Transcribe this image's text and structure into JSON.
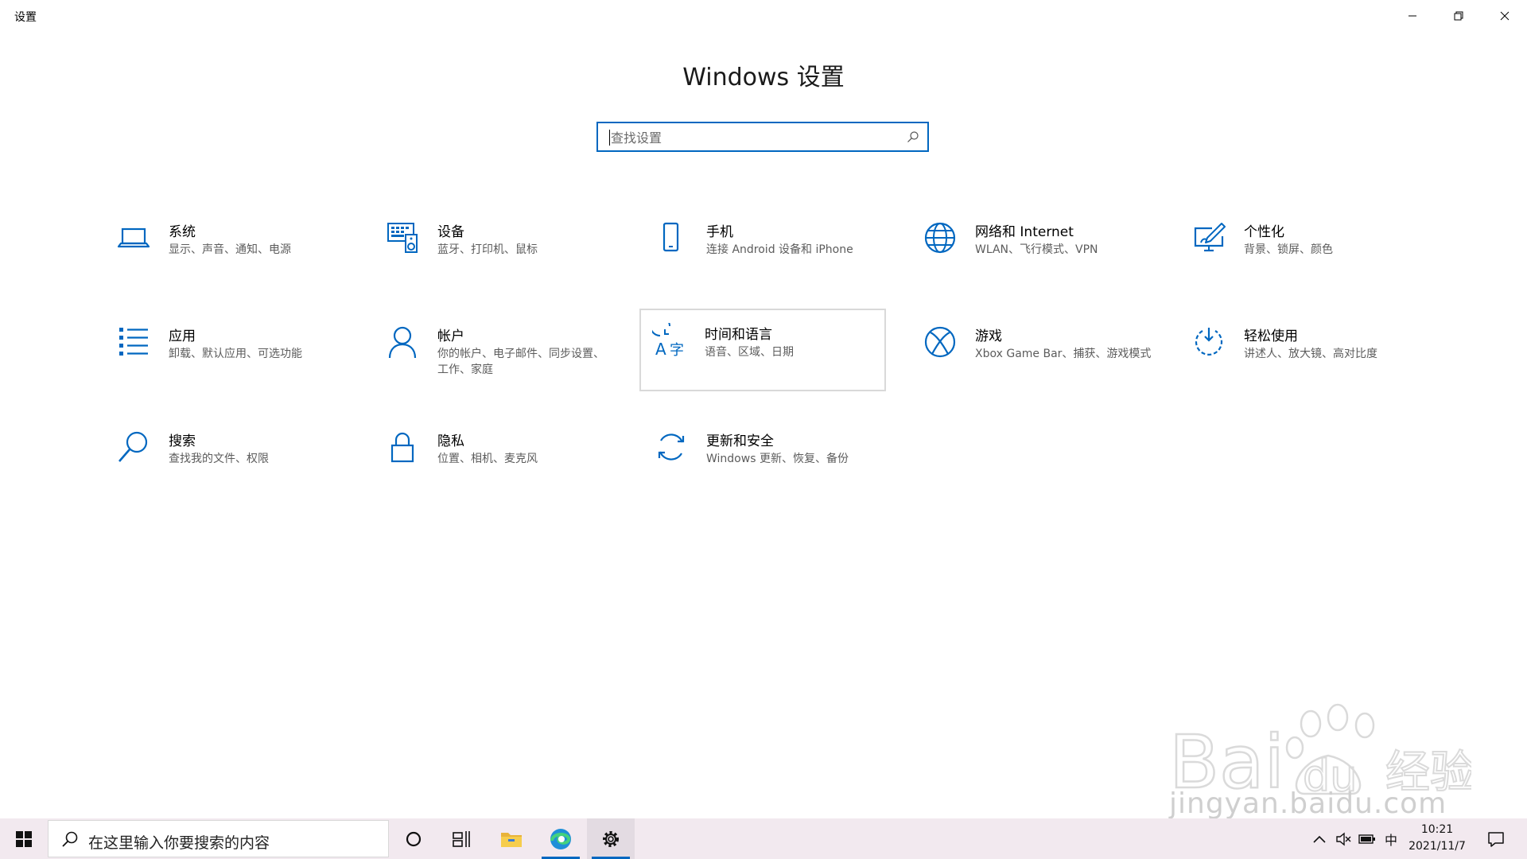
{
  "window": {
    "title": "设置"
  },
  "heading": "Windows 设置",
  "search": {
    "placeholder": "查找设置"
  },
  "tiles": [
    {
      "name": "系统",
      "desc": "显示、声音、通知、电源",
      "icon": "laptop-icon"
    },
    {
      "name": "设备",
      "desc": "蓝牙、打印机、鼠标",
      "icon": "devices-icon"
    },
    {
      "name": "手机",
      "desc": "连接 Android 设备和 iPhone",
      "icon": "phone-icon"
    },
    {
      "name": "网络和 Internet",
      "desc": "WLAN、飞行模式、VPN",
      "icon": "globe-icon"
    },
    {
      "name": "个性化",
      "desc": "背景、锁屏、颜色",
      "icon": "personalization-icon"
    },
    {
      "name": "应用",
      "desc": "卸载、默认应用、可选功能",
      "icon": "apps-list-icon"
    },
    {
      "name": "帐户",
      "desc": "你的帐户、电子邮件、同步设置、工作、家庭",
      "icon": "person-icon"
    },
    {
      "name": "时间和语言",
      "desc": "语音、区域、日期",
      "icon": "time-language-icon"
    },
    {
      "name": "游戏",
      "desc": "Xbox Game Bar、捕获、游戏模式",
      "icon": "xbox-icon"
    },
    {
      "name": "轻松使用",
      "desc": "讲述人、放大镜、高对比度",
      "icon": "ease-of-access-icon"
    },
    {
      "name": "搜索",
      "desc": "查找我的文件、权限",
      "icon": "search-icon"
    },
    {
      "name": "隐私",
      "desc": "位置、相机、麦克风",
      "icon": "lock-icon"
    },
    {
      "name": "更新和安全",
      "desc": "Windows 更新、恢复、备份",
      "icon": "refresh-icon"
    }
  ],
  "taskbar": {
    "search_text": "在这里输入你要搜索的内容",
    "ime": "中",
    "time": "10:21",
    "date": "2021/11/7"
  },
  "watermark": {
    "text": "jingyan.baidu.com"
  },
  "colors": {
    "accent": "#0067c0",
    "taskbar": "#f2e9ef"
  }
}
